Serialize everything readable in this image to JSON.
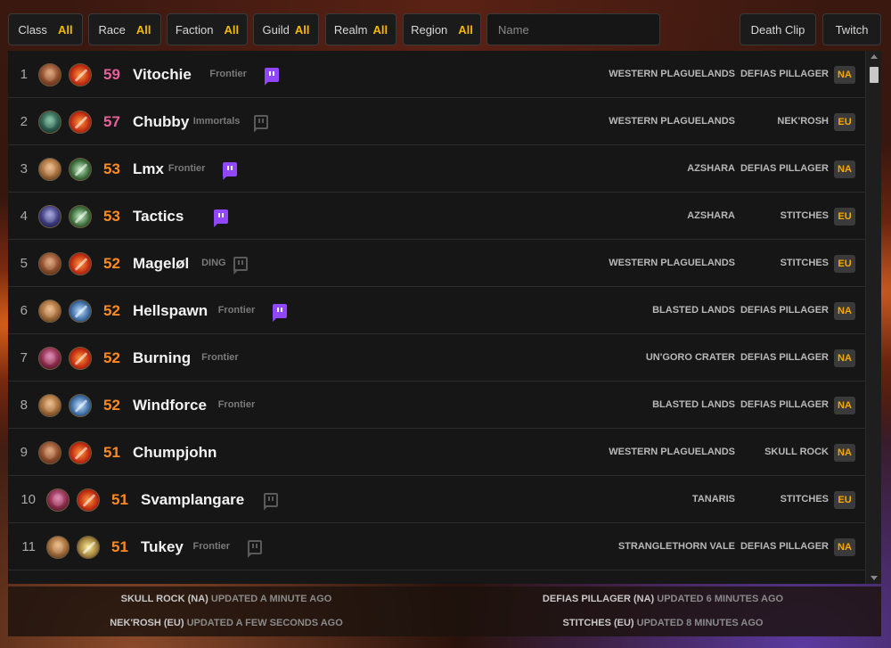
{
  "filters": {
    "class": {
      "label": "Class",
      "value": "All"
    },
    "race": {
      "label": "Race",
      "value": "All"
    },
    "faction": {
      "label": "Faction",
      "value": "All"
    },
    "guild": {
      "label": "Guild",
      "value": "All"
    },
    "realm": {
      "label": "Realm",
      "value": "All"
    },
    "region": {
      "label": "Region",
      "value": "All"
    },
    "name_placeholder": "Name",
    "death_clip": "Death Clip",
    "twitch": "Twitch"
  },
  "rows": [
    {
      "rank": "1",
      "race": "orc",
      "class": "mage",
      "level": "59",
      "level_color": "pink",
      "name": "Vitochie",
      "guild": "Frontier",
      "twitch_live": true,
      "zone": "WESTERN PLAGUELANDS",
      "realm": "DEFIAS PILLAGER",
      "region": "NA"
    },
    {
      "rank": "2",
      "race": "undead",
      "class": "mage",
      "level": "57",
      "level_color": "pink",
      "name": "Chubby",
      "guild": "Immortals",
      "twitch_live": false,
      "zone": "WESTERN PLAGUELANDS",
      "realm": "NEK'ROSH",
      "region": "EU"
    },
    {
      "rank": "3",
      "race": "human",
      "class": "rogue",
      "level": "53",
      "level_color": "orange",
      "name": "Lmx",
      "guild": "Frontier",
      "twitch_live": true,
      "zone": "AZSHARA",
      "realm": "DEFIAS PILLAGER",
      "region": "NA"
    },
    {
      "rank": "4",
      "race": "dark",
      "class": "rogue",
      "level": "53",
      "level_color": "orange",
      "name": "Tactics",
      "guild": "",
      "twitch_live": true,
      "zone": "AZSHARA",
      "realm": "STITCHES",
      "region": "EU"
    },
    {
      "rank": "5",
      "race": "orc",
      "class": "mage",
      "level": "52",
      "level_color": "orange",
      "name": "Mageløl",
      "guild": "DING",
      "twitch_live": false,
      "zone": "WESTERN PLAGUELANDS",
      "realm": "STITCHES",
      "region": "EU"
    },
    {
      "rank": "6",
      "race": "human",
      "class": "warrior",
      "level": "52",
      "level_color": "orange",
      "name": "Hellspawn",
      "guild": "Frontier",
      "twitch_live": true,
      "zone": "BLASTED LANDS",
      "realm": "DEFIAS PILLAGER",
      "region": "NA"
    },
    {
      "rank": "7",
      "race": "gnome",
      "class": "mage",
      "level": "52",
      "level_color": "orange",
      "name": "Burning",
      "guild": "Frontier",
      "twitch_live": null,
      "zone": "UN'GORO CRATER",
      "realm": "DEFIAS PILLAGER",
      "region": "NA"
    },
    {
      "rank": "8",
      "race": "human",
      "class": "warrior",
      "level": "52",
      "level_color": "orange",
      "name": "Windforce",
      "guild": "Frontier",
      "twitch_live": null,
      "zone": "BLASTED LANDS",
      "realm": "DEFIAS PILLAGER",
      "region": "NA"
    },
    {
      "rank": "9",
      "race": "orc",
      "class": "mage",
      "level": "51",
      "level_color": "orange",
      "name": "Chumpjohn",
      "guild": "",
      "twitch_live": null,
      "zone": "WESTERN PLAGUELANDS",
      "realm": "SKULL ROCK",
      "region": "NA"
    },
    {
      "rank": "10",
      "race": "gnome",
      "class": "mage",
      "level": "51",
      "level_color": "orange",
      "name": "Svamplangare",
      "guild": "",
      "twitch_live": false,
      "zone": "TANARIS",
      "realm": "STITCHES",
      "region": "EU"
    },
    {
      "rank": "11",
      "race": "human",
      "class": "paladin",
      "level": "51",
      "level_color": "orange",
      "name": "Tukey",
      "guild": "Frontier",
      "twitch_live": false,
      "zone": "STRANGLETHORN VALE",
      "realm": "DEFIAS PILLAGER",
      "region": "NA"
    }
  ],
  "footer": {
    "skull_rock": {
      "realm": "SKULL ROCK (NA)",
      "status": "UPDATED A MINUTE AGO"
    },
    "defias": {
      "realm": "DEFIAS PILLAGER (NA)",
      "status": "UPDATED 6 MINUTES AGO"
    },
    "nekrosh": {
      "realm": "NEK'ROSH (EU)",
      "status": "UPDATED A FEW SECONDS AGO"
    },
    "stitches": {
      "realm": "STITCHES (EU)",
      "status": "UPDATED 8 MINUTES AGO"
    }
  },
  "colors": {
    "accent": "#f5b800",
    "twitch": "#9146ff",
    "level_high": "#e8609a",
    "level": "#ff8a20"
  }
}
